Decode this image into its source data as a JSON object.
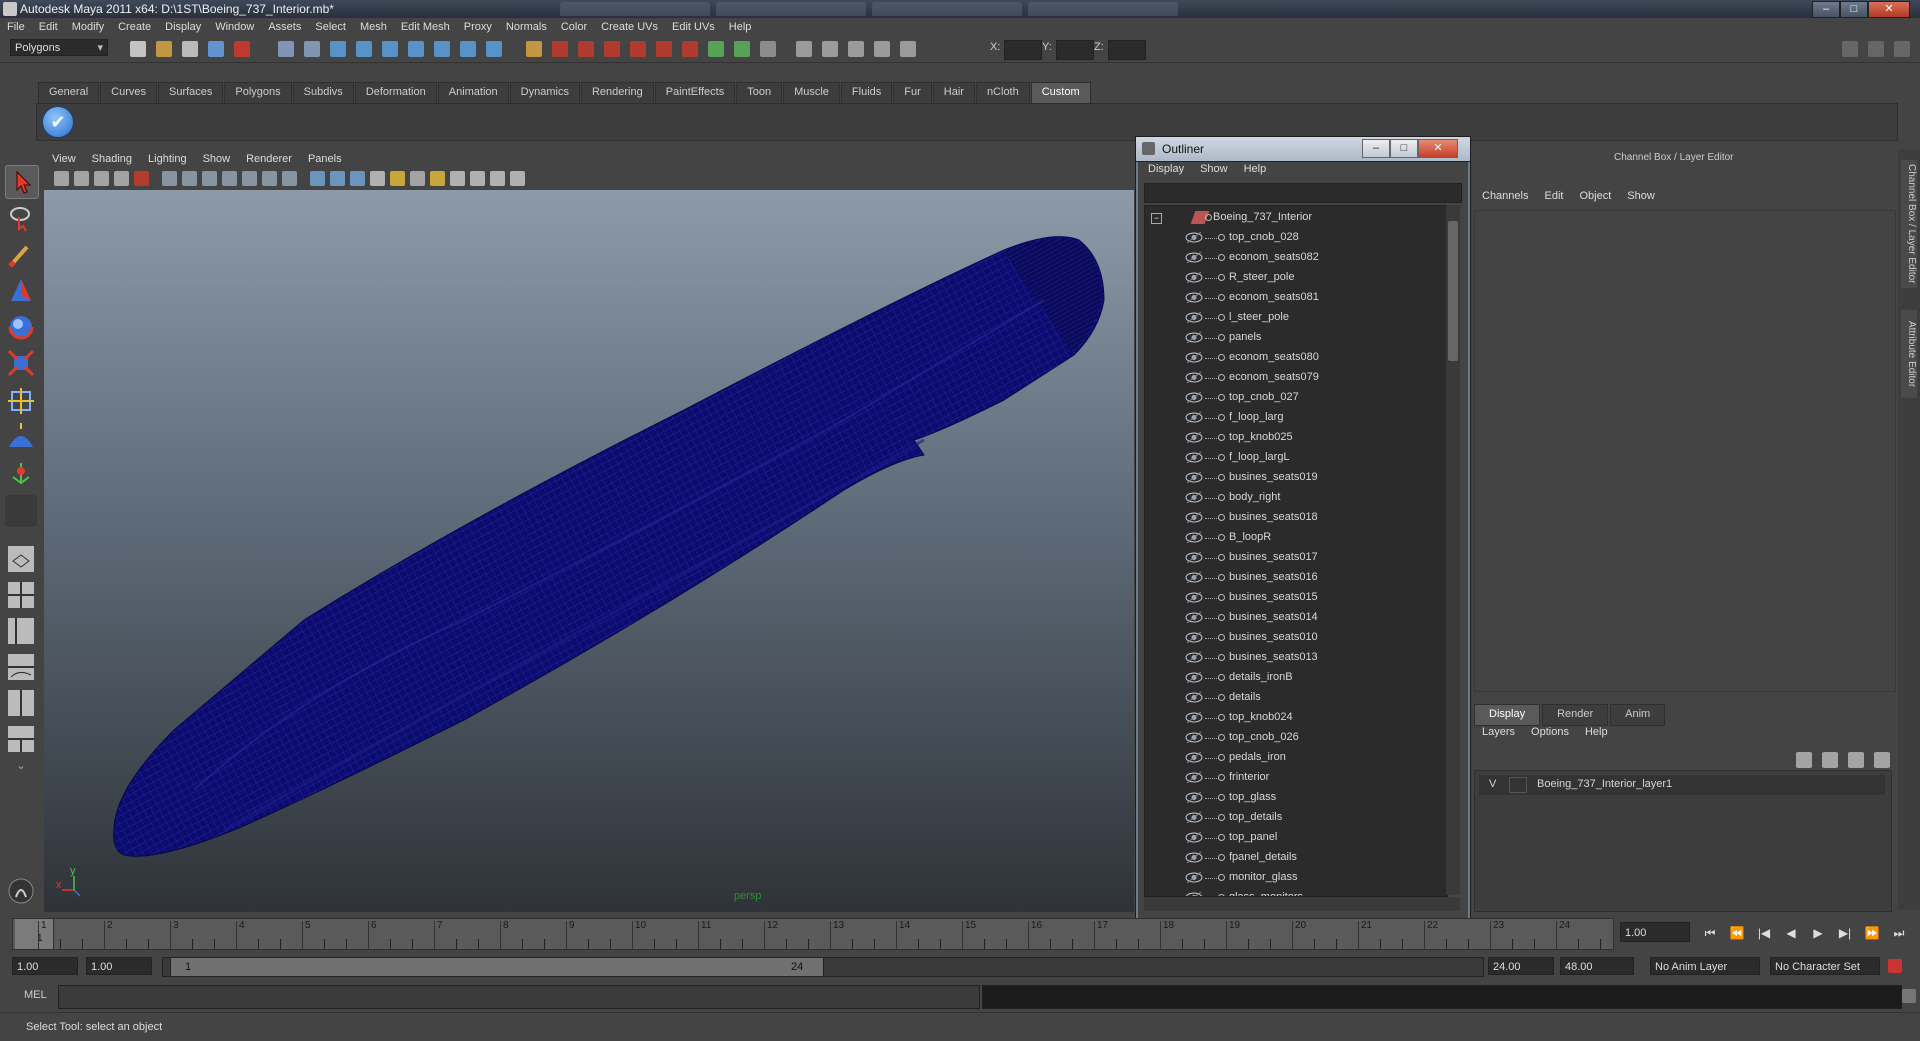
{
  "window": {
    "title": "Autodesk Maya 2011 x64: D:\\1ST\\Boeing_737_Interior.mb*",
    "minimize": "–",
    "maximize": "□",
    "close": "✕"
  },
  "menubar": [
    "File",
    "Edit",
    "Modify",
    "Create",
    "Display",
    "Window",
    "Assets",
    "Select",
    "Mesh",
    "Edit Mesh",
    "Proxy",
    "Normals",
    "Color",
    "Create UVs",
    "Edit UVs",
    "Help"
  ],
  "statusline": {
    "mode": "Polygons",
    "x_label": "X:",
    "y_label": "Y:",
    "z_label": "Z:"
  },
  "shelf": {
    "tabs": [
      "General",
      "Curves",
      "Surfaces",
      "Polygons",
      "Subdivs",
      "Deformation",
      "Animation",
      "Dynamics",
      "Rendering",
      "PaintEffects",
      "Toon",
      "Muscle",
      "Fluids",
      "Fur",
      "Hair",
      "nCloth",
      "Custom"
    ],
    "active_tab": "Custom",
    "check_icon": "✔"
  },
  "viewport": {
    "menu": [
      "View",
      "Shading",
      "Lighting",
      "Show",
      "Renderer",
      "Panels"
    ],
    "camera_label": "persp",
    "axis_x": "x",
    "axis_y": "y",
    "mesh_color": "#0c0c6e"
  },
  "outliner": {
    "title": "Outliner",
    "menu": [
      "Display",
      "Show",
      "Help"
    ],
    "root": "Boeing_737_Interior",
    "items": [
      "top_cnob_028",
      "econom_seats082",
      "R_steer_pole",
      "econom_seats081",
      "l_steer_pole",
      "panels",
      "econom_seats080",
      "econom_seats079",
      "top_cnob_027",
      "f_loop_larg",
      "top_knob025",
      "f_loop_largL",
      "busines_seats019",
      "body_right",
      "busines_seats018",
      "B_loopR",
      "busines_seats017",
      "busines_seats016",
      "busines_seats015",
      "busines_seats014",
      "busines_seats010",
      "busines_seats013",
      "details_ironB",
      "details",
      "top_knob024",
      "top_cnob_026",
      "pedals_iron",
      "frinterior",
      "top_glass",
      "top_details",
      "top_panel",
      "fpanel_details",
      "monitor_glass",
      "glass_monitors"
    ]
  },
  "channel_box": {
    "header": "Channel Box / Layer Editor",
    "menu": [
      "Channels",
      "Edit",
      "Object",
      "Show"
    ],
    "side_tabs": [
      "Channel Box / Layer Editor",
      "Attribute Editor"
    ]
  },
  "layer_editor": {
    "tabs": [
      "Display",
      "Render",
      "Anim"
    ],
    "active_tab": "Display",
    "menu": [
      "Layers",
      "Options",
      "Help"
    ],
    "layer": {
      "visible": "V",
      "name": "Boeing_737_Interior_layer1"
    }
  },
  "timeslider": {
    "ticks": [
      "1",
      "2",
      "3",
      "4",
      "5",
      "6",
      "7",
      "8",
      "9",
      "10",
      "11",
      "12",
      "13",
      "14",
      "15",
      "16",
      "17",
      "18",
      "19",
      "20",
      "21",
      "22",
      "23",
      "24"
    ],
    "current_frame": "1",
    "current_frame_field": "1.00"
  },
  "playback": [
    "⏮",
    "⏪",
    "|◀",
    "◀",
    "▶",
    "▶|",
    "⏩",
    "⏭"
  ],
  "range": {
    "start": "1.00",
    "playback_start": "1.00",
    "handle_start": "1",
    "handle_end": "24",
    "playback_end": "24.00",
    "end": "48.00",
    "anim_layer": "No Anim Layer",
    "character_set": "No Character Set"
  },
  "commandline": {
    "label": "MEL"
  },
  "helpline": "Select Tool: select an object"
}
